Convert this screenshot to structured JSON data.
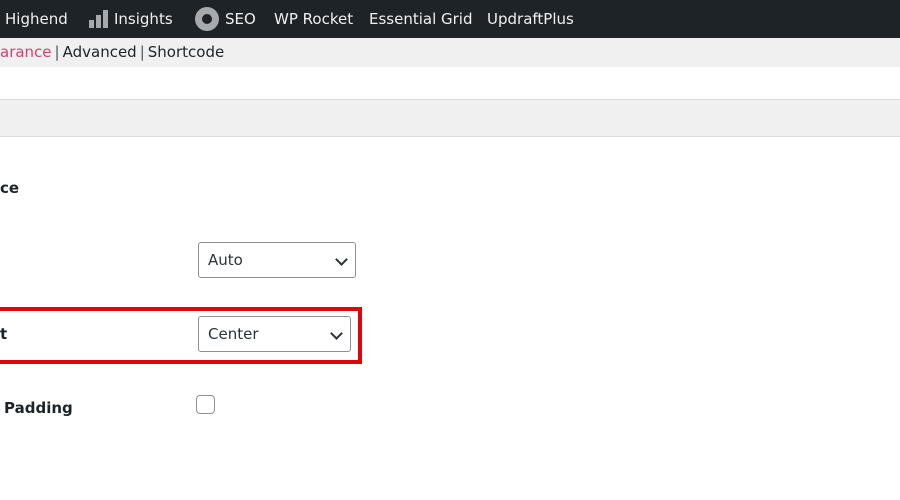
{
  "admin_bar": {
    "items": [
      {
        "label": "Highend",
        "icon": null
      },
      {
        "label": "Insights",
        "icon": "bar-chart-icon"
      },
      {
        "label": "SEO",
        "icon": "seo-gear-icon"
      },
      {
        "label": "WP Rocket",
        "icon": null
      },
      {
        "label": "Essential Grid",
        "icon": null
      },
      {
        "label": "UpdraftPlus",
        "icon": null
      }
    ]
  },
  "subnav": {
    "items": [
      "arance",
      "Advanced",
      "Shortcode"
    ],
    "separator": "|",
    "active_color": "#d63f6e"
  },
  "section": {
    "title": "ce"
  },
  "fields": [
    {
      "label": "",
      "value": "Auto"
    },
    {
      "label": "t",
      "value": "Center",
      "highlight_color": "#e0040b"
    },
    {
      "label": "Padding",
      "checked": false
    }
  ]
}
